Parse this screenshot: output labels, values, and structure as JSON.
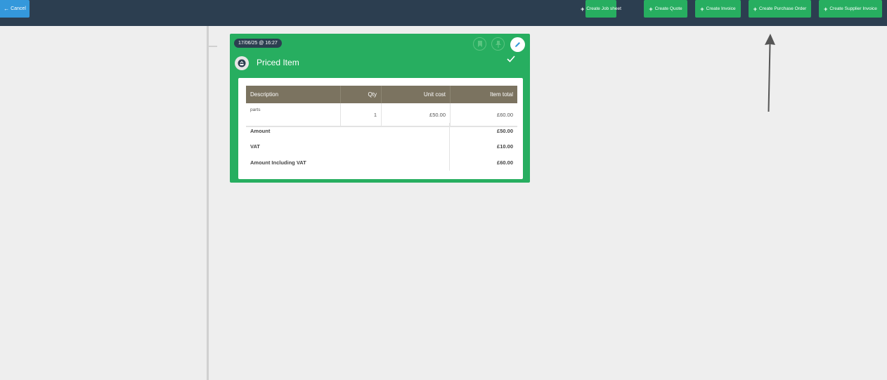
{
  "topbar": {
    "cancel_label": "Cancel",
    "actions": [
      {
        "label": "Create Job sheet"
      },
      {
        "label": "Create Quote"
      },
      {
        "label": "Create Invoice"
      },
      {
        "label": "Create Purchase Order"
      },
      {
        "label": "Create Supplier Invoice"
      }
    ]
  },
  "card": {
    "timestamp": "17/06/25 @ 16:27",
    "title": "Priced Item",
    "table": {
      "headers": {
        "description": "Description",
        "qty": "Qty",
        "unit_cost": "Unit cost",
        "item_total": "Item total"
      },
      "rows": [
        {
          "description": "parts",
          "qty": "1",
          "unit_cost": "£50.00",
          "item_total": "£60.00"
        }
      ]
    },
    "totals": {
      "amount_label": "Amount",
      "amount_value": "£50.00",
      "vat_label": "VAT",
      "vat_value": "£10.00",
      "incl_label": "Amount Including VAT",
      "incl_value": "£60.00"
    }
  },
  "colors": {
    "topbar": "#2c3e50",
    "cancel": "#3498db",
    "action": "#27ae60",
    "card": "#27ae60",
    "table_header": "#7b7360"
  },
  "icons": {
    "cancel": "arrow-left-icon",
    "action": "plus-icon",
    "card_type": "item-icon",
    "pin": "pin-icon",
    "bookmark": "bookmark-icon",
    "edit": "pencil-icon",
    "status": "check-icon"
  }
}
